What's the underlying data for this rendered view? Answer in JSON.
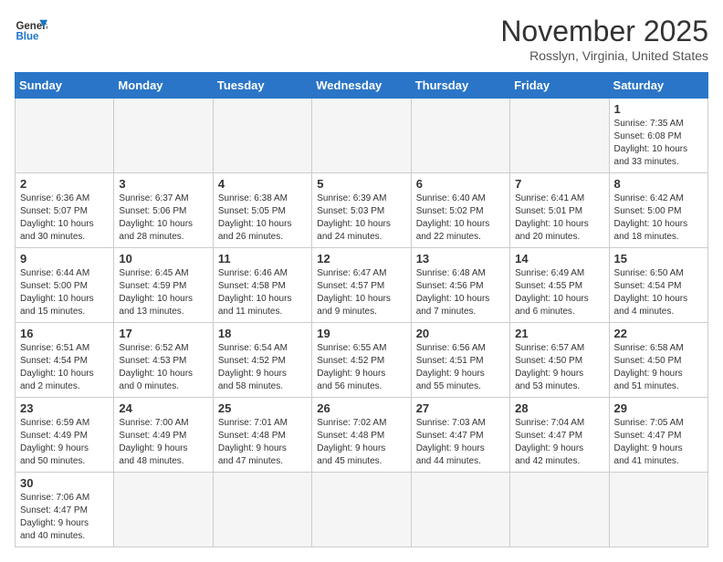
{
  "header": {
    "logo_line1": "General",
    "logo_line2": "Blue",
    "month": "November 2025",
    "location": "Rosslyn, Virginia, United States"
  },
  "weekdays": [
    "Sunday",
    "Monday",
    "Tuesday",
    "Wednesday",
    "Thursday",
    "Friday",
    "Saturday"
  ],
  "weeks": [
    [
      {
        "day": "",
        "info": ""
      },
      {
        "day": "",
        "info": ""
      },
      {
        "day": "",
        "info": ""
      },
      {
        "day": "",
        "info": ""
      },
      {
        "day": "",
        "info": ""
      },
      {
        "day": "",
        "info": ""
      },
      {
        "day": "1",
        "info": "Sunrise: 7:35 AM\nSunset: 6:08 PM\nDaylight: 10 hours\nand 33 minutes."
      }
    ],
    [
      {
        "day": "2",
        "info": "Sunrise: 6:36 AM\nSunset: 5:07 PM\nDaylight: 10 hours\nand 30 minutes."
      },
      {
        "day": "3",
        "info": "Sunrise: 6:37 AM\nSunset: 5:06 PM\nDaylight: 10 hours\nand 28 minutes."
      },
      {
        "day": "4",
        "info": "Sunrise: 6:38 AM\nSunset: 5:05 PM\nDaylight: 10 hours\nand 26 minutes."
      },
      {
        "day": "5",
        "info": "Sunrise: 6:39 AM\nSunset: 5:03 PM\nDaylight: 10 hours\nand 24 minutes."
      },
      {
        "day": "6",
        "info": "Sunrise: 6:40 AM\nSunset: 5:02 PM\nDaylight: 10 hours\nand 22 minutes."
      },
      {
        "day": "7",
        "info": "Sunrise: 6:41 AM\nSunset: 5:01 PM\nDaylight: 10 hours\nand 20 minutes."
      },
      {
        "day": "8",
        "info": "Sunrise: 6:42 AM\nSunset: 5:00 PM\nDaylight: 10 hours\nand 18 minutes."
      }
    ],
    [
      {
        "day": "9",
        "info": "Sunrise: 6:44 AM\nSunset: 5:00 PM\nDaylight: 10 hours\nand 15 minutes."
      },
      {
        "day": "10",
        "info": "Sunrise: 6:45 AM\nSunset: 4:59 PM\nDaylight: 10 hours\nand 13 minutes."
      },
      {
        "day": "11",
        "info": "Sunrise: 6:46 AM\nSunset: 4:58 PM\nDaylight: 10 hours\nand 11 minutes."
      },
      {
        "day": "12",
        "info": "Sunrise: 6:47 AM\nSunset: 4:57 PM\nDaylight: 10 hours\nand 9 minutes."
      },
      {
        "day": "13",
        "info": "Sunrise: 6:48 AM\nSunset: 4:56 PM\nDaylight: 10 hours\nand 7 minutes."
      },
      {
        "day": "14",
        "info": "Sunrise: 6:49 AM\nSunset: 4:55 PM\nDaylight: 10 hours\nand 6 minutes."
      },
      {
        "day": "15",
        "info": "Sunrise: 6:50 AM\nSunset: 4:54 PM\nDaylight: 10 hours\nand 4 minutes."
      }
    ],
    [
      {
        "day": "16",
        "info": "Sunrise: 6:51 AM\nSunset: 4:54 PM\nDaylight: 10 hours\nand 2 minutes."
      },
      {
        "day": "17",
        "info": "Sunrise: 6:52 AM\nSunset: 4:53 PM\nDaylight: 10 hours\nand 0 minutes."
      },
      {
        "day": "18",
        "info": "Sunrise: 6:54 AM\nSunset: 4:52 PM\nDaylight: 9 hours\nand 58 minutes."
      },
      {
        "day": "19",
        "info": "Sunrise: 6:55 AM\nSunset: 4:52 PM\nDaylight: 9 hours\nand 56 minutes."
      },
      {
        "day": "20",
        "info": "Sunrise: 6:56 AM\nSunset: 4:51 PM\nDaylight: 9 hours\nand 55 minutes."
      },
      {
        "day": "21",
        "info": "Sunrise: 6:57 AM\nSunset: 4:50 PM\nDaylight: 9 hours\nand 53 minutes."
      },
      {
        "day": "22",
        "info": "Sunrise: 6:58 AM\nSunset: 4:50 PM\nDaylight: 9 hours\nand 51 minutes."
      }
    ],
    [
      {
        "day": "23",
        "info": "Sunrise: 6:59 AM\nSunset: 4:49 PM\nDaylight: 9 hours\nand 50 minutes."
      },
      {
        "day": "24",
        "info": "Sunrise: 7:00 AM\nSunset: 4:49 PM\nDaylight: 9 hours\nand 48 minutes."
      },
      {
        "day": "25",
        "info": "Sunrise: 7:01 AM\nSunset: 4:48 PM\nDaylight: 9 hours\nand 47 minutes."
      },
      {
        "day": "26",
        "info": "Sunrise: 7:02 AM\nSunset: 4:48 PM\nDaylight: 9 hours\nand 45 minutes."
      },
      {
        "day": "27",
        "info": "Sunrise: 7:03 AM\nSunset: 4:47 PM\nDaylight: 9 hours\nand 44 minutes."
      },
      {
        "day": "28",
        "info": "Sunrise: 7:04 AM\nSunset: 4:47 PM\nDaylight: 9 hours\nand 42 minutes."
      },
      {
        "day": "29",
        "info": "Sunrise: 7:05 AM\nSunset: 4:47 PM\nDaylight: 9 hours\nand 41 minutes."
      }
    ],
    [
      {
        "day": "30",
        "info": "Sunrise: 7:06 AM\nSunset: 4:47 PM\nDaylight: 9 hours\nand 40 minutes."
      },
      {
        "day": "",
        "info": ""
      },
      {
        "day": "",
        "info": ""
      },
      {
        "day": "",
        "info": ""
      },
      {
        "day": "",
        "info": ""
      },
      {
        "day": "",
        "info": ""
      },
      {
        "day": "",
        "info": ""
      }
    ]
  ]
}
